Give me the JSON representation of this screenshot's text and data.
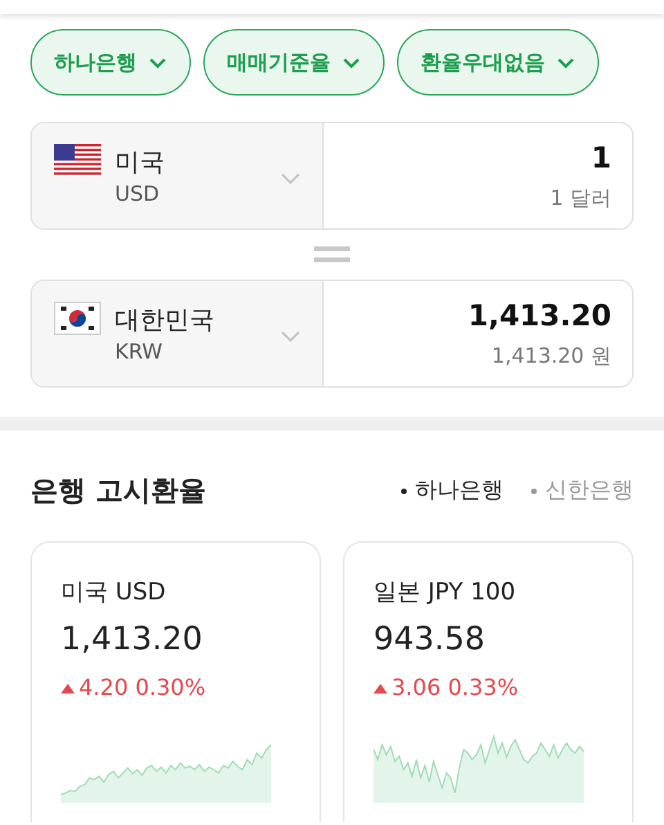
{
  "filters": [
    {
      "label": "하나은행"
    },
    {
      "label": "매매기준율"
    },
    {
      "label": "환율우대없음"
    }
  ],
  "converter": [
    {
      "kind": "us",
      "country": "미국",
      "code": "USD",
      "amount": "1",
      "amount_text": "1 달러"
    },
    {
      "kind": "kr",
      "country": "대한민국",
      "code": "KRW",
      "amount": "1,413.20",
      "amount_text": "1,413.20 원"
    }
  ],
  "section": {
    "title": "은행 고시환율",
    "banks": [
      {
        "label": "하나은행",
        "selected": true
      },
      {
        "label": "신한은행",
        "selected": false
      }
    ]
  },
  "cards": [
    {
      "name": "미국 USD",
      "rate": "1,413.20",
      "kind": "up",
      "change": "4.20 0.30%"
    },
    {
      "name": "일본 JPY 100",
      "rate": "943.58",
      "kind": "up",
      "change": "3.06 0.33%"
    }
  ]
}
